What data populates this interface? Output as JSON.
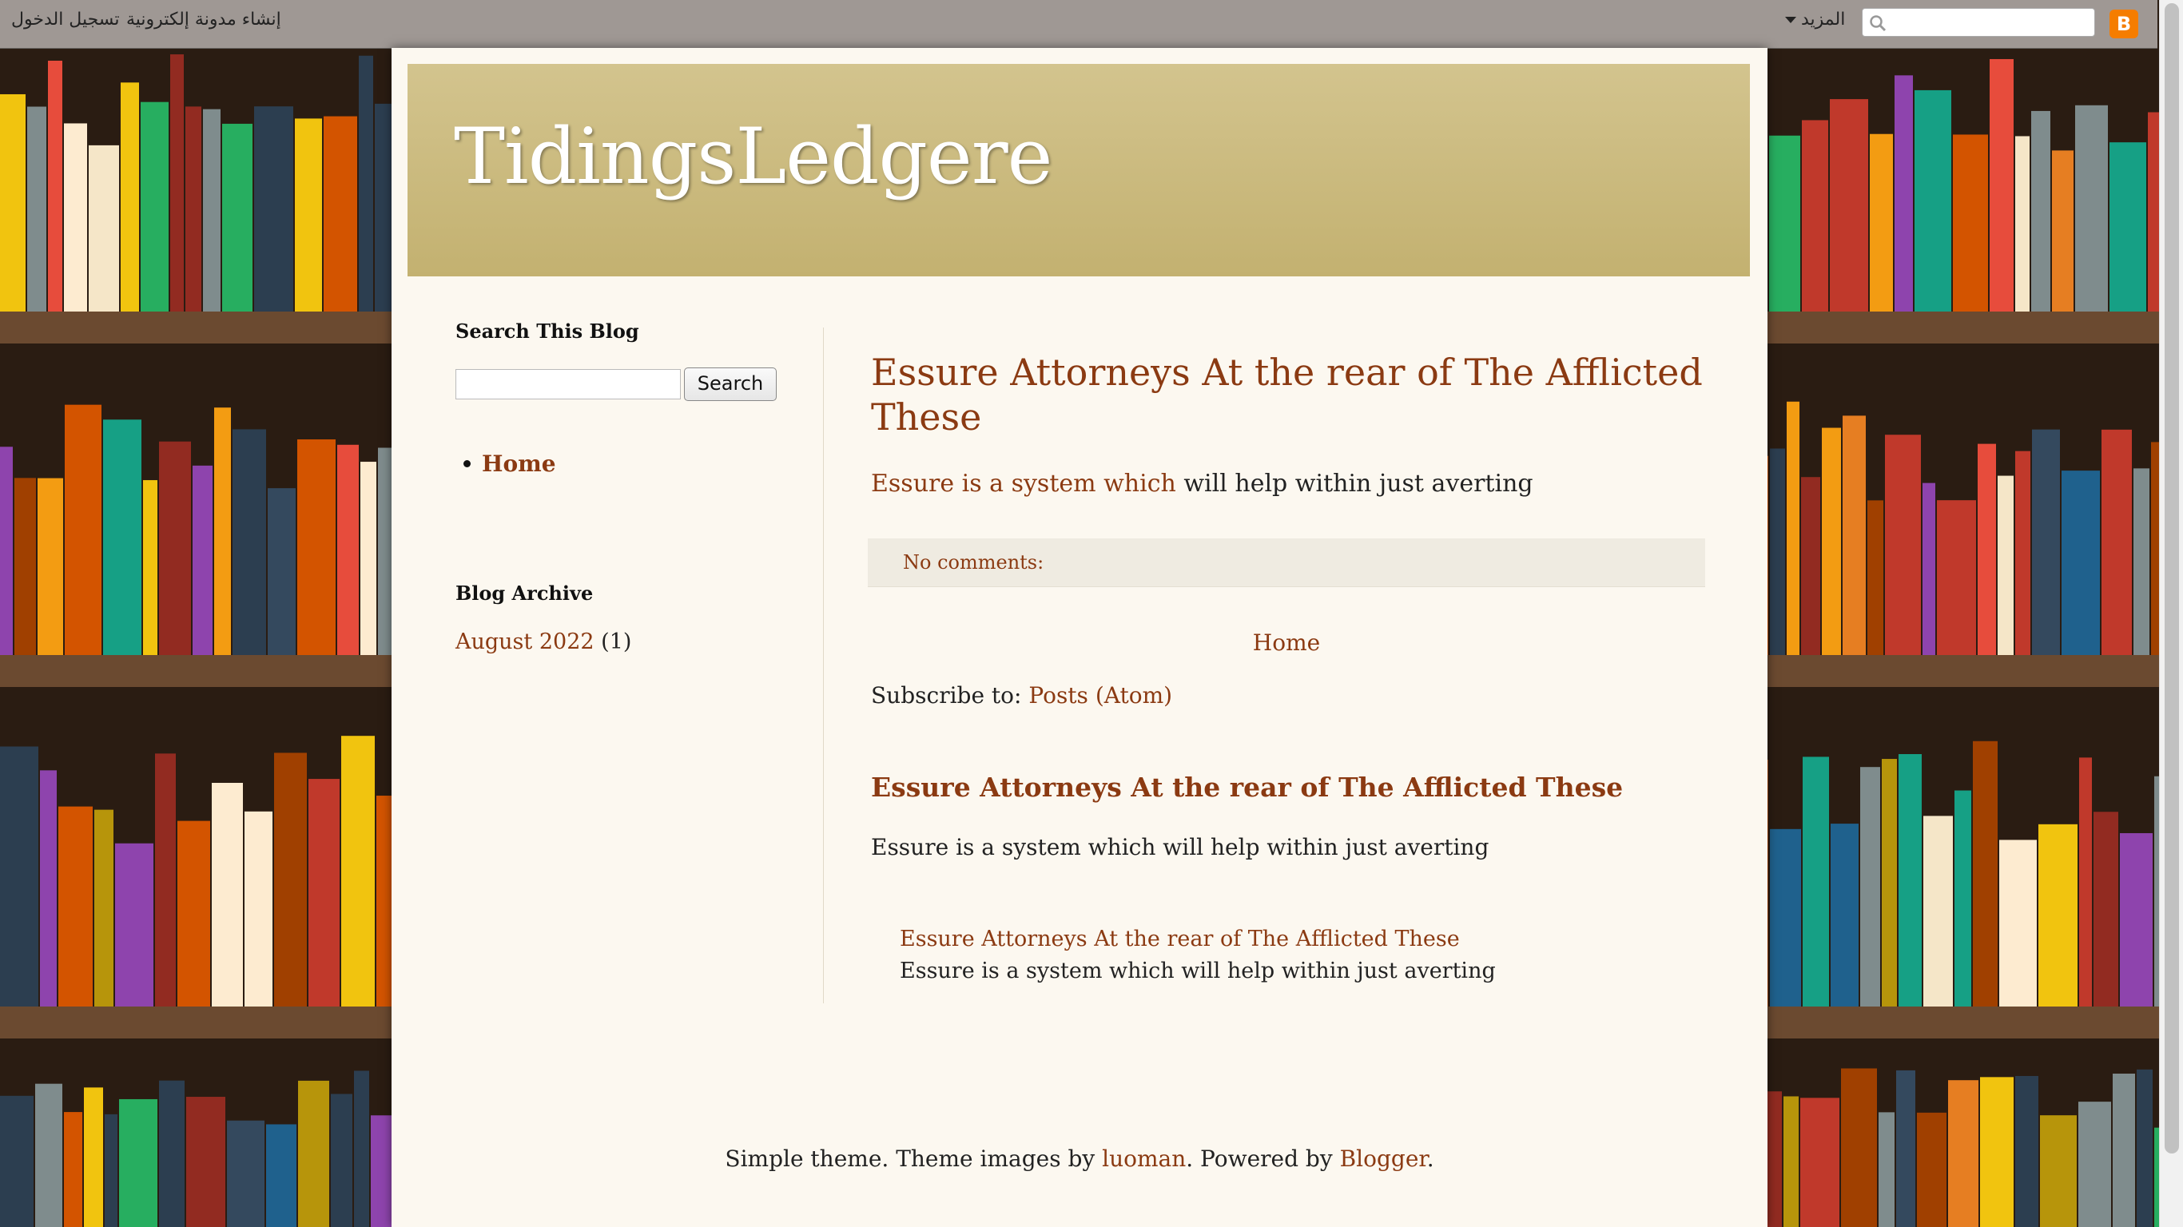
{
  "navbar": {
    "login": "تسجيل الدخول",
    "create_blog": "إنشاء مدونة إلكترونية",
    "more": "المزيد",
    "search_placeholder": "",
    "blogger_icon": "blogger-logo-icon"
  },
  "header": {
    "title": "TidingsLedgere"
  },
  "sidebar": {
    "search_title": "Search This Blog",
    "search_value": "",
    "search_button": "Search",
    "pages": [
      {
        "label": "Home"
      }
    ],
    "archive_title": "Blog Archive",
    "archive": [
      {
        "label": "August 2022",
        "count": "(1)"
      }
    ]
  },
  "post": {
    "title": "Essure Attorneys At the rear of The Afflicted These",
    "body_link": "Essure is a system which",
    "body_rest": " will help within just averting",
    "comments": "No comments:"
  },
  "blog_pager": {
    "home": "Home"
  },
  "subscribe": {
    "label": "Subscribe to: ",
    "link": "Posts (Atom)"
  },
  "popular": {
    "title": "Essure Attorneys At the rear of The Afflicted These",
    "snippet": "Essure is a system which will help within just averting"
  },
  "related": {
    "title": "Essure Attorneys At the rear of The Afflicted These",
    "snippet": "Essure is a system which will help within just averting"
  },
  "footer": {
    "prefix": "Simple theme. Theme images by ",
    "author": "luoman",
    "middle": ". Powered by ",
    "platform": "Blogger",
    "suffix": "."
  },
  "colors": {
    "link": "#8b3a12",
    "header_bg": "#c8b87a",
    "page_bg": "#fcf8f0"
  }
}
